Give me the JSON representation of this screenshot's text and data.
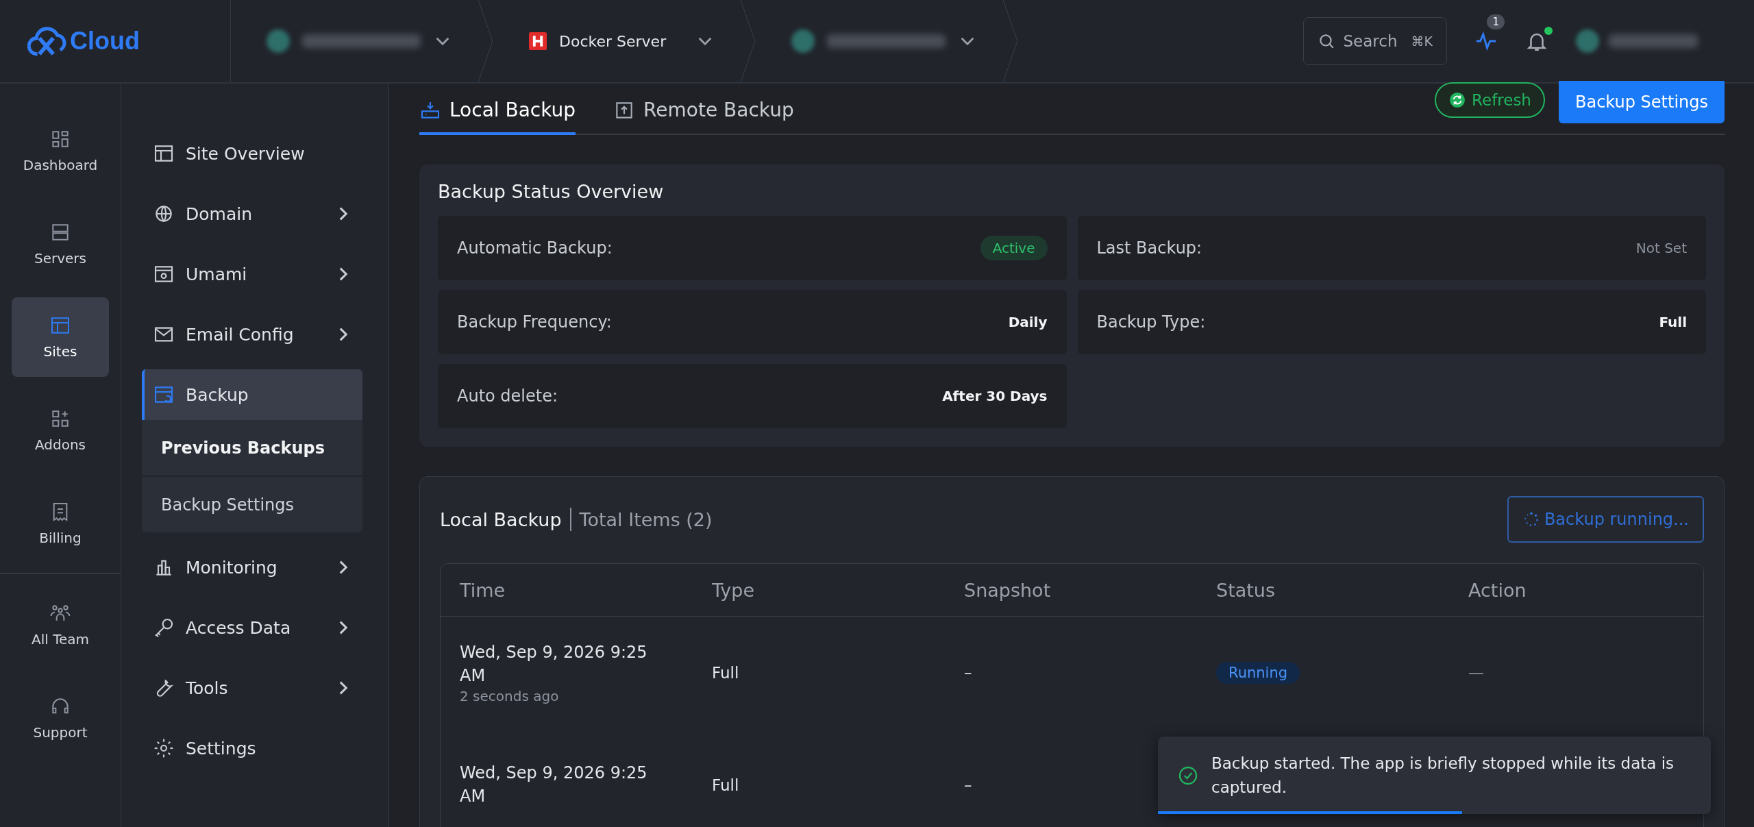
{
  "brand": {
    "name": "Cloud"
  },
  "breadcrumbs": [
    {
      "kind": "blurred"
    },
    {
      "kind": "server",
      "label": "Docker Server"
    },
    {
      "kind": "blurred"
    }
  ],
  "search": {
    "placeholder": "Search",
    "shortcut": "⌘K"
  },
  "activity": {
    "count": "1"
  },
  "notifications": {
    "unread": true
  },
  "rail": [
    {
      "label": "Dashboard",
      "selected": false
    },
    {
      "label": "Servers",
      "selected": false
    },
    {
      "label": "Sites",
      "selected": true
    },
    {
      "label": "Addons",
      "selected": false
    },
    {
      "label": "Billing",
      "selected": false
    },
    {
      "label": "All Team",
      "selected": false
    },
    {
      "label": "Support",
      "selected": false
    }
  ],
  "menu": [
    {
      "label": "Site Overview",
      "expandable": false,
      "selected": false
    },
    {
      "label": "Domain",
      "expandable": true,
      "selected": false
    },
    {
      "label": "Umami",
      "expandable": true,
      "selected": false
    },
    {
      "label": "Email Config",
      "expandable": true,
      "selected": false
    },
    {
      "label": "Backup",
      "expandable": false,
      "selected": true,
      "children": [
        {
          "label": "Previous Backups",
          "selected": true
        },
        {
          "label": "Backup Settings",
          "selected": false
        }
      ]
    },
    {
      "label": "Monitoring",
      "expandable": true,
      "selected": false
    },
    {
      "label": "Access Data",
      "expandable": true,
      "selected": false
    },
    {
      "label": "Tools",
      "expandable": true,
      "selected": false
    },
    {
      "label": "Settings",
      "expandable": false,
      "selected": false
    }
  ],
  "tabs": [
    {
      "label": "Local Backup",
      "selected": true
    },
    {
      "label": "Remote Backup",
      "selected": false
    }
  ],
  "actions": {
    "refresh": "Refresh",
    "settings": "Backup Settings"
  },
  "overview": {
    "title": "Backup Status Overview",
    "items": [
      {
        "label": "Automatic Backup:",
        "value": "Active",
        "kind": "badge"
      },
      {
        "label": "Last Backup:",
        "value": "Not Set",
        "kind": "muted"
      },
      {
        "label": "Backup Frequency:",
        "value": "Daily",
        "kind": "text"
      },
      {
        "label": "Backup Type:",
        "value": "Full",
        "kind": "text"
      },
      {
        "label": "Auto delete:",
        "value": "After 30 Days",
        "kind": "text"
      }
    ]
  },
  "backups": {
    "title": "Local Backup",
    "count": "Total Items (2)",
    "running_button": "Backup running...",
    "columns": [
      "Time",
      "Type",
      "Snapshot",
      "Status",
      "Action"
    ],
    "rows": [
      {
        "time": "Wed, Sep 9, 2026 9:25 AM",
        "ago": "2 seconds ago",
        "type": "Full",
        "snapshot": "–",
        "status": "Running",
        "action": "—"
      },
      {
        "time": "Wed, Sep 9, 2026 9:25 AM",
        "type": "Full",
        "snapshot": "–"
      }
    ]
  },
  "toast": {
    "message": "Backup started. The app is briefly stopped while its data is captured.",
    "level": 0.55
  }
}
